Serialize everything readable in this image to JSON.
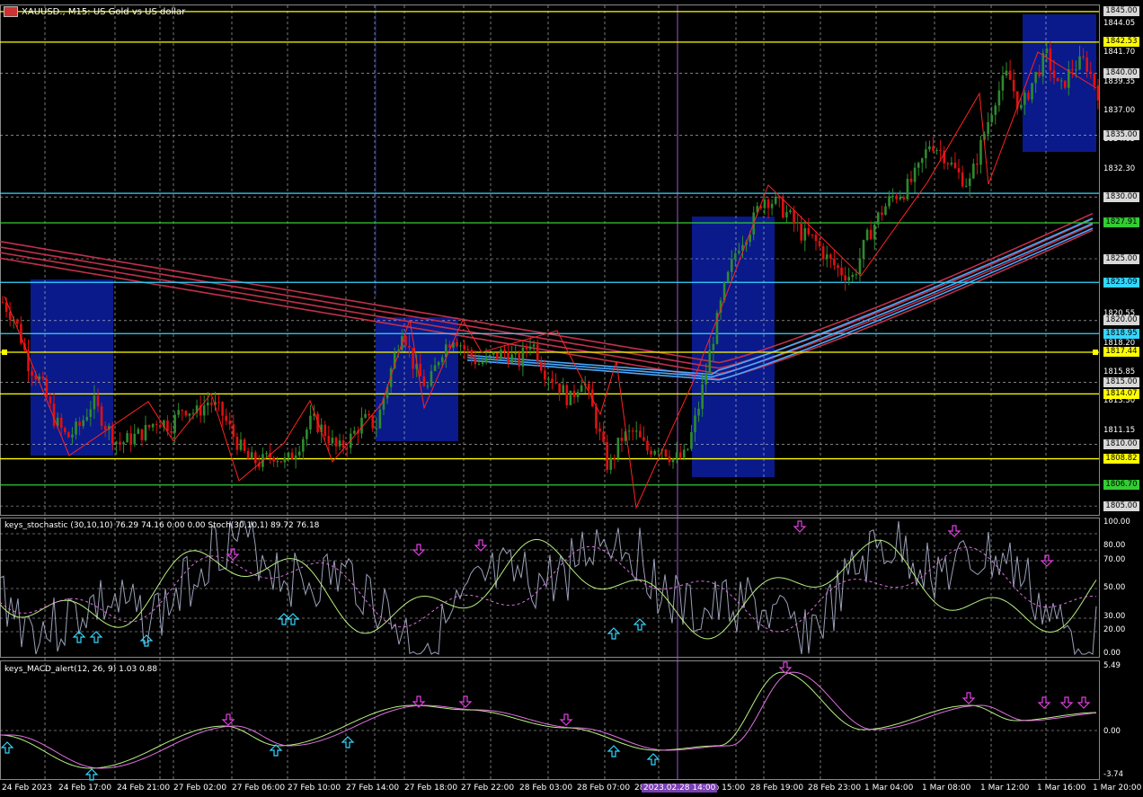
{
  "window": {
    "title": "XAUUSD., M15: US Gold vs US dollar",
    "icon": "chart-window-icon"
  },
  "colors": {
    "background": "#000000",
    "grid": "#c8c8c8",
    "bull_candle": "#2e8b2e",
    "bear_candle": "#e01010",
    "yellow_line": "#ffff00",
    "green_line": "#33cc33",
    "cyan_line": "#33d6ff",
    "session_box": "#0a1a8a",
    "ma_red": "#c0304a",
    "ma_blue": "#4aa8ff",
    "zigzag": "#ff2222",
    "current_price_bg": "#2a2a2a"
  },
  "price_axis": {
    "ticks": [
      "1845.00",
      "1844.05",
      "1842.53",
      "1841.70",
      "1840.00",
      "1839.35",
      "1837.00",
      "1835.00",
      "1834.65",
      "1832.30",
      "1830.00",
      "1827.91",
      "1825.00",
      "1823.09",
      "1820.55",
      "1820.00",
      "1818.95",
      "1818.20",
      "1817.44",
      "1815.85",
      "1815.00",
      "1814.07",
      "1813.50",
      "1811.15",
      "1810.00",
      "1808.82",
      "1806.70",
      "1805.00"
    ],
    "labels": [
      {
        "text": "1845.00",
        "kind": "box-white"
      },
      {
        "text": "1842.53",
        "kind": "yellow"
      },
      {
        "text": "1840.00",
        "kind": "box-white"
      },
      {
        "text": "1835.00",
        "kind": "box-white"
      },
      {
        "text": "1830.00",
        "kind": "box-white"
      },
      {
        "text": "1827.91",
        "kind": "green"
      },
      {
        "text": "1825.00",
        "kind": "box-white"
      },
      {
        "text": "1823.09",
        "kind": "cyan"
      },
      {
        "text": "1820.00",
        "kind": "box-white"
      },
      {
        "text": "1818.95",
        "kind": "cyan"
      },
      {
        "text": "1817.44",
        "kind": "yellow"
      },
      {
        "text": "1815.00",
        "kind": "box-white"
      },
      {
        "text": "1814.07",
        "kind": "yellow"
      },
      {
        "text": "1810.00",
        "kind": "box-white"
      },
      {
        "text": "1808.82",
        "kind": "yellow"
      },
      {
        "text": "1806.70",
        "kind": "green"
      },
      {
        "text": "1805.00",
        "kind": "box-white"
      }
    ]
  },
  "stoch": {
    "title": "keys_stochastic (30,10,10) 76.29 74.16 0.00 0.00 Stoch(30,10,1) 89.72 76.18",
    "ticks": [
      "100.00",
      "80.00",
      "70.00",
      "50.00",
      "30.00",
      "20.00",
      "0.00"
    ]
  },
  "macd": {
    "title": "keys_MACD_alert(12, 26, 9) 1.03 0.88",
    "ticks": [
      "5.49",
      "0.00",
      "-3.74"
    ]
  },
  "time_axis": {
    "labels": [
      "24 Feb 2023",
      "24 Feb 17:00",
      "24 Feb 21:00",
      "27 Feb 02:00",
      "27 Feb 06:00",
      "27 Feb 10:00",
      "27 Feb 14:00",
      "27 Feb 18:00",
      "27 Feb 22:00",
      "28 Feb 03:00",
      "28 Feb 07:00",
      "28 Feb 11:00",
      "28 Feb 15:00",
      "28 Feb 19:00",
      "28 Feb 23:00",
      "1 Mar 04:00",
      "1 Mar 08:00",
      "1 Mar 12:00",
      "1 Mar 16:00",
      "1 Mar 20:00"
    ],
    "cursor_label": "2023.02.28 14:00"
  },
  "chart_data": {
    "type": "candlestick",
    "symbol": "XAUUSD.",
    "timeframe": "M15",
    "ylim": [
      1804.5,
      1845.5
    ],
    "horizontal_levels": [
      {
        "price": 1845.0,
        "color": "yellow"
      },
      {
        "price": 1842.53,
        "color": "yellow"
      },
      {
        "price": 1830.3,
        "color": "cyan"
      },
      {
        "price": 1827.91,
        "color": "green"
      },
      {
        "price": 1823.09,
        "color": "cyan"
      },
      {
        "price": 1818.95,
        "color": "cyan"
      },
      {
        "price": 1817.44,
        "color": "yellow"
      },
      {
        "price": 1814.07,
        "color": "yellow"
      },
      {
        "price": 1808.82,
        "color": "yellow"
      },
      {
        "price": 1806.7,
        "color": "green"
      }
    ],
    "close_path": [
      1821.5,
      1820.0,
      1816.5,
      1815.0,
      1812.0,
      1810.5,
      1811.5,
      1813.5,
      1811.5,
      1810.0,
      1810.5,
      1811.0,
      1812.0,
      1811.5,
      1813.0,
      1812.5,
      1813.5,
      1812.5,
      1810.5,
      1808.8,
      1808.5,
      1809.2,
      1808.5,
      1810.0,
      1812.0,
      1811.0,
      1809.5,
      1810.5,
      1812.0,
      1811.5,
      1815.5,
      1819.5,
      1816.0,
      1814.5,
      1817.5,
      1818.8,
      1817.5,
      1816.5,
      1817.0,
      1817.5,
      1816.5,
      1818.5,
      1816.0,
      1815.0,
      1813.5,
      1815.5,
      1812.0,
      1808.0,
      1810.5,
      1811.0,
      1809.5,
      1810.0,
      1808.8,
      1809.0,
      1813.0,
      1818.0,
      1822.5,
      1826.0,
      1827.5,
      1830.0,
      1829.5,
      1828.5,
      1827.0,
      1826.5,
      1825.0,
      1824.0,
      1823.5,
      1826.5,
      1828.5,
      1830.0,
      1830.5,
      1832.0,
      1834.5,
      1833.5,
      1832.0,
      1831.0,
      1834.5,
      1838.0,
      1840.0,
      1837.0,
      1839.5,
      1841.5,
      1838.5,
      1840.5,
      1841.0,
      1838.5
    ]
  }
}
